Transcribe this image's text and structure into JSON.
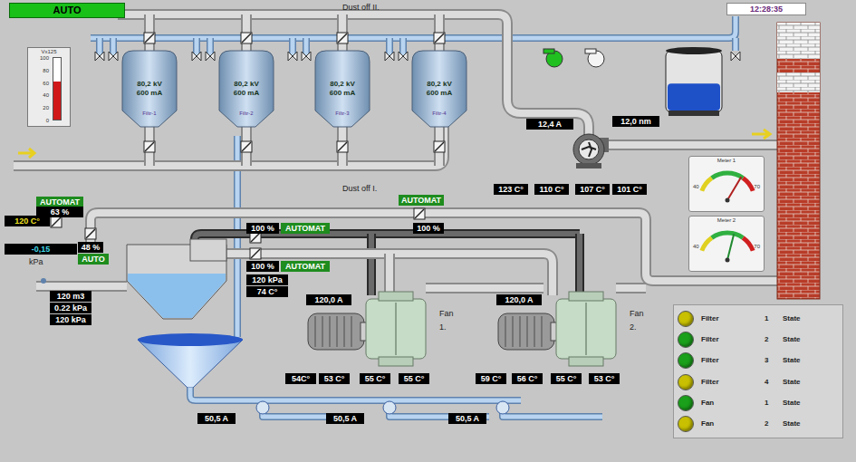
{
  "mode": "AUTO",
  "clock": "12:28:35",
  "gauge": {
    "title": "Vx125",
    "ticks": [
      "100",
      "80",
      "60",
      "40",
      "20",
      "0"
    ],
    "level": 0.62
  },
  "dust_off_2": {
    "title": "Dust off II.",
    "filters": [
      {
        "name": "Filtr-1",
        "voltage": "80,2 kV",
        "current": "600 mA"
      },
      {
        "name": "Filtr-2",
        "voltage": "80,2 kV",
        "current": "600 mA"
      },
      {
        "name": "Filtr-3",
        "voltage": "80,2 kV",
        "current": "600 mA"
      },
      {
        "name": "Filtr-4",
        "voltage": "80,2 kV",
        "current": "600 mA"
      }
    ],
    "blowers": [
      {
        "on": true
      },
      {
        "on": false
      }
    ],
    "tank": {
      "level": 0.45
    },
    "fan": {
      "current": "12,4 A",
      "speed": "12,0 nm",
      "temperatures": [
        "123 C°",
        "110 C°",
        "107 C°",
        "101 C°"
      ]
    }
  },
  "dust_off_1": {
    "title": "Dust off I.",
    "inlet": {
      "mode": "AUTOMAT",
      "opening": "63 %",
      "temperature": "120 C°",
      "valve_opening": "48 %",
      "pressure": "-0,15",
      "pressure_unit": "kPa",
      "valve_mode": "AUTO"
    },
    "main_valve": {
      "mode": "AUTOMAT",
      "opening": "100 %"
    },
    "duct_valves": [
      {
        "opening": "100 %",
        "mode": "AUTOMAT"
      },
      {
        "opening": "100 %",
        "mode": "AUTOMAT"
      }
    ],
    "duct": {
      "pressure": "120 kPa",
      "temperature": "74 C°"
    },
    "hopper": {
      "volume": "120 m3",
      "pressure": "0.22 kPa",
      "pressure_2": "120 kPa"
    },
    "fans": [
      {
        "name": "Fan",
        "number": "1.",
        "current": "120,0 A",
        "temperatures": [
          "54C°",
          "53 C°",
          "55 C°",
          "55 C°"
        ]
      },
      {
        "name": "Fan",
        "number": "2.",
        "current": "120,0 A",
        "temperatures": [
          "59 C°",
          "56 C°",
          "55 C°",
          "53 C°"
        ]
      }
    ],
    "pumps": [
      {
        "current": "50,5 A"
      },
      {
        "current": "50,5 A"
      },
      {
        "current": "50,5 A"
      }
    ]
  },
  "meters": [
    {
      "title": "Meter 1",
      "min": "40",
      "max": "70",
      "level": 0.72
    },
    {
      "title": "Meter 2",
      "min": "40",
      "max": "70",
      "level": 0.6
    }
  ],
  "status": [
    {
      "device": "Filter",
      "number": "1",
      "label": "State",
      "color": "#c8c000"
    },
    {
      "device": "Filter",
      "number": "2",
      "label": "State",
      "color": "#1aa01a"
    },
    {
      "device": "Filter",
      "number": "3",
      "label": "State",
      "color": "#1aa01a"
    },
    {
      "device": "Filter",
      "number": "4",
      "label": "State",
      "color": "#c8c000"
    },
    {
      "device": "Fan",
      "number": "1",
      "label": "State",
      "color": "#1aa01a"
    },
    {
      "device": "Fan",
      "number": "2",
      "label": "State",
      "color": "#c8c000"
    }
  ]
}
